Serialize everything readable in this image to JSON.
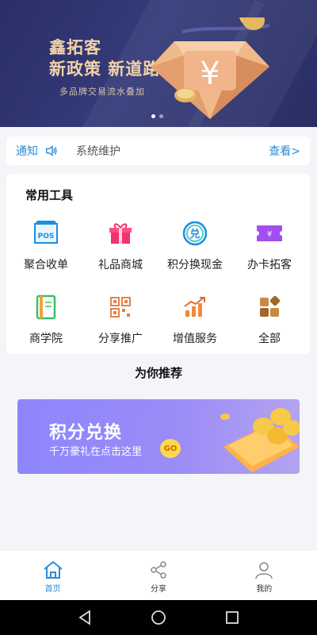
{
  "banner": {
    "title_line1": "鑫拓客",
    "title_line2": "新政策 新道路",
    "subtitle": "多品牌交易流水叠加",
    "coin_symbol": "¥",
    "page_count": 2,
    "active_page": 1
  },
  "notice": {
    "label": "通知",
    "text": "系统维护",
    "more": "查看>"
  },
  "tools": {
    "heading": "常用工具",
    "items": [
      {
        "label": "聚合收单",
        "icon": "pos-icon"
      },
      {
        "label": "礼品商城",
        "icon": "gift-icon"
      },
      {
        "label": "积分换现金",
        "icon": "points-exchange-icon"
      },
      {
        "label": "办卡拓客",
        "icon": "card-icon"
      },
      {
        "label": "商学院",
        "icon": "book-icon"
      },
      {
        "label": "分享推广",
        "icon": "qr-code-icon"
      },
      {
        "label": "增值服务",
        "icon": "growth-chart-icon"
      },
      {
        "label": "全部",
        "icon": "all-apps-icon"
      }
    ]
  },
  "recommend": {
    "title": "为你推荐",
    "promo_title": "积分兑换",
    "promo_subtitle": "千万豪礼在点击这里",
    "promo_go": "GO"
  },
  "bottom_nav": {
    "items": [
      {
        "label": "首页",
        "icon": "home-icon"
      },
      {
        "label": "分享",
        "icon": "share-icon"
      },
      {
        "label": "我的",
        "icon": "profile-icon"
      }
    ],
    "active": 0
  },
  "colors": {
    "accent": "#2a8cd9",
    "banner_bg": "#2e3470",
    "gold_text": "#f2d3a8",
    "promo": "#8e86ff"
  }
}
